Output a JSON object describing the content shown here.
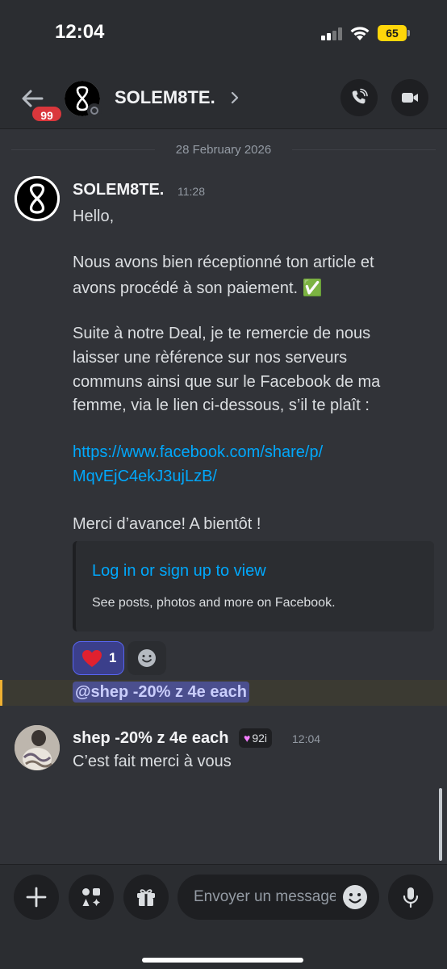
{
  "status_bar": {
    "time": "12:04",
    "battery": "65"
  },
  "header": {
    "channel_name": "SOLEM8TE.",
    "unread_badge": "99",
    "back_icon": "arrow-left-icon",
    "call_icon": "phone-icon",
    "video_icon": "video-camera-icon"
  },
  "date_divider": "28 February 2026",
  "messages": [
    {
      "author": "SOLEM8TE.",
      "time": "11:28",
      "lines": [
        "Hello,",
        "Nous avons bien réceptionné ton article et",
        "avons procédé à son paiement. ✅",
        "Suite à notre Deal, je te remercie de nous",
        "laisser une rèférence sur nos serveurs",
        "communs ainsi que sur le Facebook de ma",
        "femme, via le lien ci-dessous, s’il te plaît :",
        "https://www.facebook.com/share/p/",
        "MqvEjC4ekJ3ujLzB/",
        "Merci d’avance! A bientôt !"
      ],
      "embed": {
        "title": "Log in or sign up to view",
        "description": "See posts, photos and more on Facebook."
      },
      "reactions": [
        {
          "emoji": "heart-emoji",
          "count": "1"
        }
      ]
    },
    {
      "author": "shep -20% z 4e each",
      "tag": "92i",
      "time": "12:04",
      "text": "C’est fait merci à vous"
    }
  ],
  "mention": "@shep -20% z 4e each",
  "composer": {
    "placeholder": "Envoyer un message",
    "plus_icon": "plus-icon",
    "apps_icon": "apps-icon",
    "gift_icon": "gift-icon",
    "mic_icon": "microphone-icon"
  },
  "colors": {
    "background": "#313338",
    "header": "#2b2d31",
    "link": "#00a8fc",
    "mention_bar": "#f0b132",
    "badge": "#da373c",
    "reaction_border": "#5865f2"
  }
}
